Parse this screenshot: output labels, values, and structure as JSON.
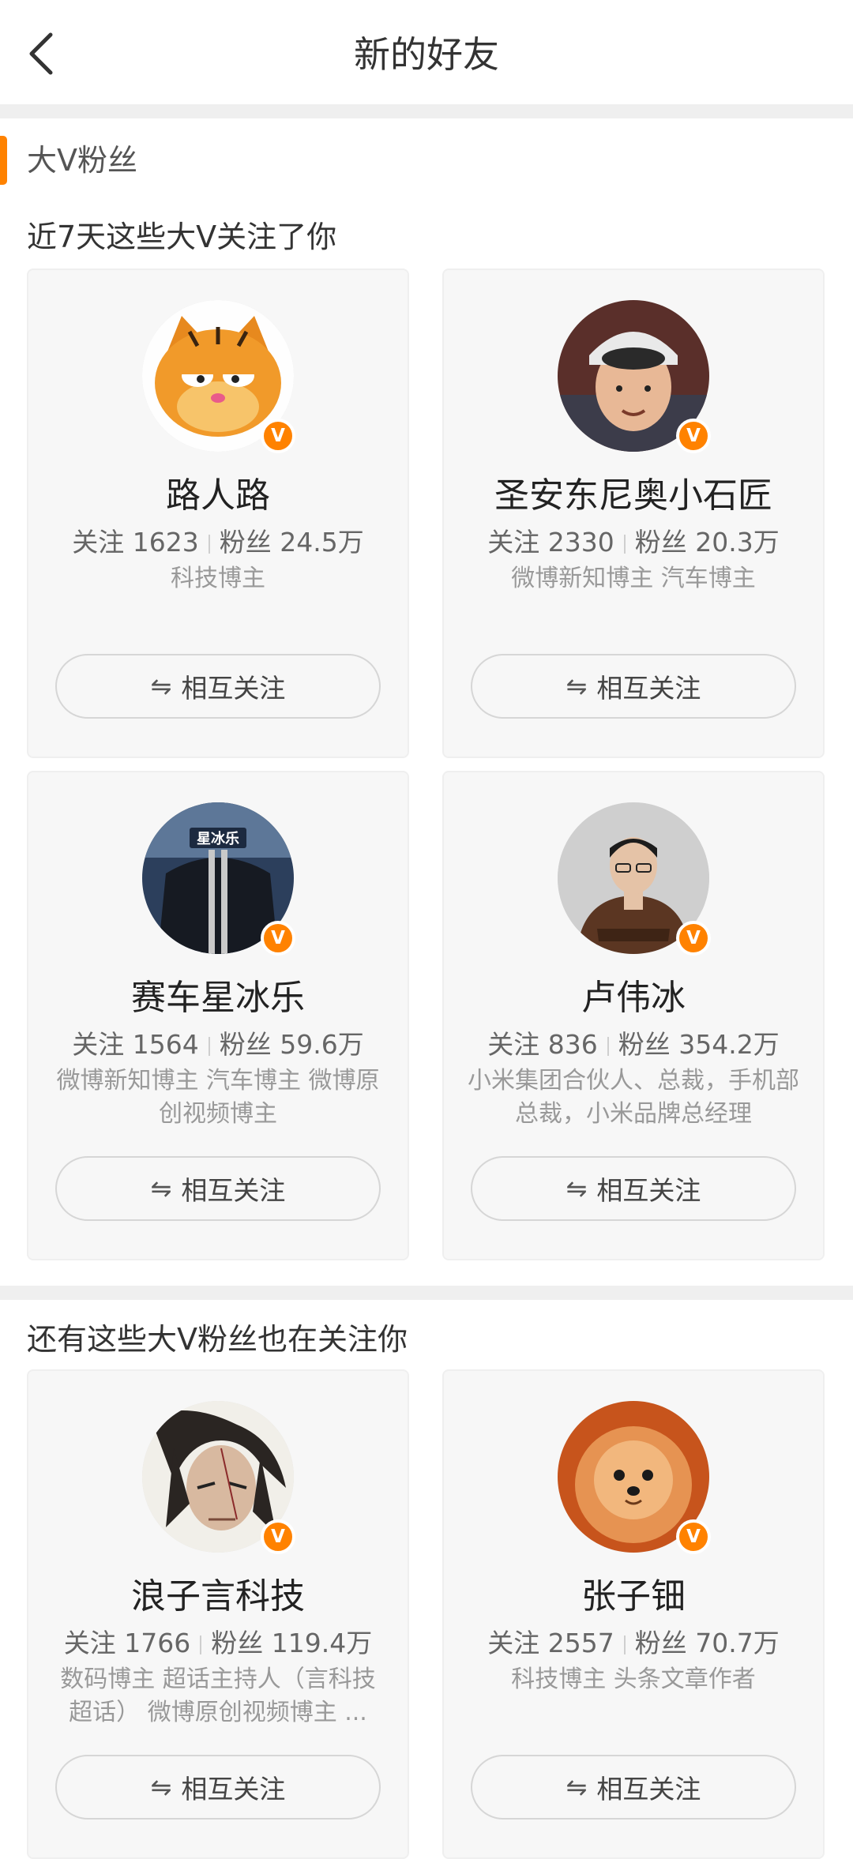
{
  "header": {
    "title": "新的好友"
  },
  "section": {
    "title": "大V粉丝",
    "accent_color": "#ff8200"
  },
  "groups": [
    {
      "title": "近7天这些大V关注了你"
    },
    {
      "title": "还有这些大V粉丝也在关注你"
    }
  ],
  "labels": {
    "following": "关注",
    "fans": "粉丝",
    "mutual": "相互关注",
    "mutual_icon": "⇋",
    "badge": "V"
  },
  "badge_color": "#ff8200",
  "cards": [
    {
      "name": "路人路",
      "following": "1623",
      "fans": "24.5万",
      "desc": "科技博主",
      "avatar": "garfield-avatar"
    },
    {
      "name": "圣安东尼奥小石匠",
      "following": "2330",
      "fans": "20.3万",
      "desc": "微博新知博主 汽车博主",
      "avatar": "child-photo-avatar"
    },
    {
      "name": "赛车星冰乐",
      "following": "1564",
      "fans": "59.6万",
      "desc": "微博新知博主 汽车博主 微博原创视频博主",
      "avatar": "car-avatar"
    },
    {
      "name": "卢伟冰",
      "following": "836",
      "fans": "354.2万",
      "desc": "小米集团合伙人、总裁，手机部总裁，小米品牌总经理",
      "avatar": "man-portrait-avatar"
    },
    {
      "name": "浪子言科技",
      "following": "1766",
      "fans": "119.4万",
      "desc": "数码博主 超话主持人（言科技超话） 微博原创视频博主 ...",
      "avatar": "samurai-avatar"
    },
    {
      "name": "张子钿",
      "following": "2557",
      "fans": "70.7万",
      "desc": "科技博主 头条文章作者",
      "avatar": "pomeranian-avatar"
    }
  ]
}
